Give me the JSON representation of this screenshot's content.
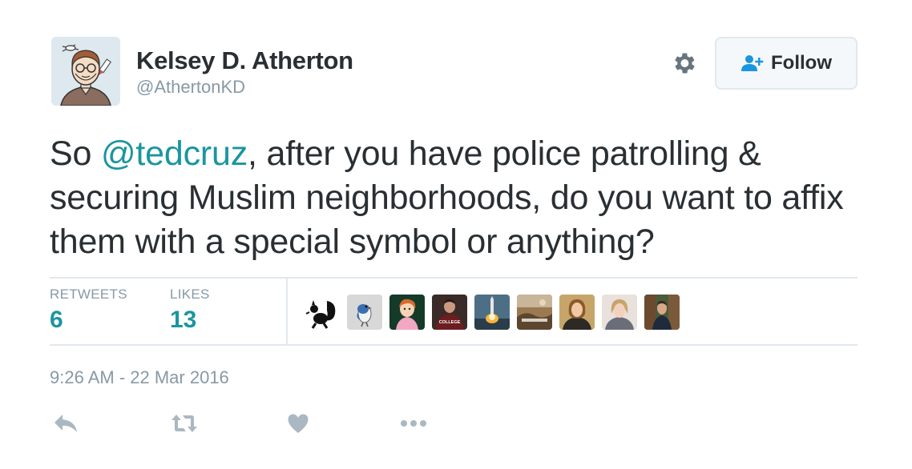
{
  "user": {
    "name": "Kelsey D. Atherton",
    "handle": "@AthertonKD"
  },
  "follow_button": {
    "label": "Follow"
  },
  "tweet": {
    "text_prefix": "So ",
    "mention": "@tedcruz",
    "text_rest": ", after you have police patrolling & securing Muslim neighborhoods, do you want to affix them with a special symbol or anything?"
  },
  "stats": {
    "retweets_label": "RETWEETS",
    "retweets_count": "6",
    "likes_label": "LIKES",
    "likes_count": "13"
  },
  "liker_avatars": [
    {
      "icon": "squirrel-silhouette"
    },
    {
      "icon": "bird-drawing"
    },
    {
      "icon": "cartoon-character"
    },
    {
      "icon": "college-shirt-photo",
      "caption": "COLLEGE"
    },
    {
      "icon": "rocket-launch-photo"
    },
    {
      "icon": "landscape-photo"
    },
    {
      "icon": "person-photo"
    },
    {
      "icon": "person-photo"
    },
    {
      "icon": "person-outdoors-photo"
    }
  ],
  "timestamp": "9:26 AM - 22 Mar 2016",
  "actions": {
    "reply_icon": "reply-icon",
    "retweet_icon": "retweet-icon",
    "like_icon": "heart-icon",
    "more_icon": "more-dots-icon"
  },
  "colors": {
    "link": "#1b95a0",
    "text": "#292f33",
    "muted": "#8899a6",
    "action_icon": "#aab8c2",
    "border": "#e1e8ed"
  }
}
